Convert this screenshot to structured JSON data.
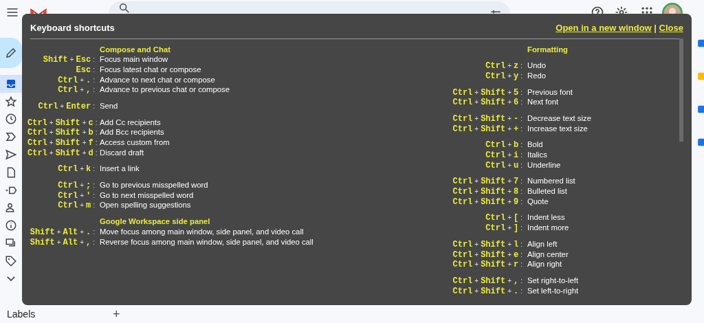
{
  "sidebar": {
    "items": [
      {
        "kind": "inbox",
        "selected": true
      },
      {
        "kind": "star",
        "selected": false
      },
      {
        "kind": "clock",
        "selected": false
      },
      {
        "kind": "important",
        "selected": false
      },
      {
        "kind": "send",
        "selected": false
      },
      {
        "kind": "file",
        "selected": false
      },
      {
        "kind": "label",
        "selected": false
      },
      {
        "kind": "people",
        "selected": false
      },
      {
        "kind": "info",
        "selected": false
      },
      {
        "kind": "forum",
        "selected": false
      },
      {
        "kind": "tag",
        "selected": false
      },
      {
        "kind": "chevron",
        "selected": false
      }
    ],
    "labels_heading": "Labels",
    "add_label": "+"
  },
  "shortcuts_dialog": {
    "title": "Keyboard shortcuts",
    "links": [
      {
        "label": "Open in a new window"
      },
      {
        "label": "Close"
      }
    ],
    "link_divider": "|",
    "key_joiner": "+",
    "separator": ":",
    "columns": [
      {
        "sections": [
          {
            "heading": "Compose and Chat",
            "groups": [
              [
                {
                  "keys": [
                    "Shift",
                    "Esc"
                  ],
                  "action": "Focus main window"
                },
                {
                  "keys": [
                    "Esc"
                  ],
                  "action": "Focus latest chat or compose"
                },
                {
                  "keys": [
                    "Ctrl",
                    "."
                  ],
                  "action": "Advance to next chat or compose"
                },
                {
                  "keys": [
                    "Ctrl",
                    ","
                  ],
                  "action": "Advance to previous chat or compose"
                }
              ],
              [
                {
                  "keys": [
                    "Ctrl",
                    "Enter"
                  ],
                  "action": "Send"
                }
              ],
              [
                {
                  "keys": [
                    "Ctrl",
                    "Shift",
                    "c"
                  ],
                  "action": "Add Cc recipients"
                },
                {
                  "keys": [
                    "Ctrl",
                    "Shift",
                    "b"
                  ],
                  "action": "Add Bcc recipients"
                },
                {
                  "keys": [
                    "Ctrl",
                    "Shift",
                    "f"
                  ],
                  "action": "Access custom from"
                },
                {
                  "keys": [
                    "Ctrl",
                    "Shift",
                    "d"
                  ],
                  "action": "Discard draft"
                }
              ],
              [
                {
                  "keys": [
                    "Ctrl",
                    "k"
                  ],
                  "action": "Insert a link"
                }
              ],
              [
                {
                  "keys": [
                    "Ctrl",
                    ";"
                  ],
                  "action": "Go to previous misspelled word"
                },
                {
                  "keys": [
                    "Ctrl",
                    "'"
                  ],
                  "action": "Go to next misspelled word"
                },
                {
                  "keys": [
                    "Ctrl",
                    "m"
                  ],
                  "action": "Open spelling suggestions"
                }
              ]
            ]
          },
          {
            "heading": "Google Workspace side panel",
            "groups": [
              [
                {
                  "keys": [
                    "Shift",
                    "Alt",
                    "."
                  ],
                  "action": "Move focus among main window, side panel, and video call"
                },
                {
                  "keys": [
                    "Shift",
                    "Alt",
                    ","
                  ],
                  "action": "Reverse focus among main window, side panel, and video call"
                }
              ]
            ]
          }
        ]
      },
      {
        "sections": [
          {
            "heading": "Formatting",
            "groups": [
              [
                {
                  "keys": [
                    "Ctrl",
                    "z"
                  ],
                  "action": "Undo"
                },
                {
                  "keys": [
                    "Ctrl",
                    "y"
                  ],
                  "action": "Redo"
                }
              ],
              [
                {
                  "keys": [
                    "Ctrl",
                    "Shift",
                    "5"
                  ],
                  "action": "Previous font"
                },
                {
                  "keys": [
                    "Ctrl",
                    "Shift",
                    "6"
                  ],
                  "action": "Next font"
                }
              ],
              [
                {
                  "keys": [
                    "Ctrl",
                    "Shift",
                    "-"
                  ],
                  "action": "Decrease text size"
                },
                {
                  "keys": [
                    "Ctrl",
                    "Shift",
                    "+"
                  ],
                  "action": "Increase text size"
                }
              ],
              [
                {
                  "keys": [
                    "Ctrl",
                    "b"
                  ],
                  "action": "Bold"
                },
                {
                  "keys": [
                    "Ctrl",
                    "i"
                  ],
                  "action": "Italics"
                },
                {
                  "keys": [
                    "Ctrl",
                    "u"
                  ],
                  "action": "Underline"
                }
              ],
              [
                {
                  "keys": [
                    "Ctrl",
                    "Shift",
                    "7"
                  ],
                  "action": "Numbered list"
                },
                {
                  "keys": [
                    "Ctrl",
                    "Shift",
                    "8"
                  ],
                  "action": "Bulleted list"
                },
                {
                  "keys": [
                    "Ctrl",
                    "Shift",
                    "9"
                  ],
                  "action": "Quote"
                }
              ],
              [
                {
                  "keys": [
                    "Ctrl",
                    "["
                  ],
                  "action": "Indent less"
                },
                {
                  "keys": [
                    "Ctrl",
                    "]"
                  ],
                  "action": "Indent more"
                }
              ],
              [
                {
                  "keys": [
                    "Ctrl",
                    "Shift",
                    "l"
                  ],
                  "action": "Align left"
                },
                {
                  "keys": [
                    "Ctrl",
                    "Shift",
                    "e"
                  ],
                  "action": "Align center"
                },
                {
                  "keys": [
                    "Ctrl",
                    "Shift",
                    "r"
                  ],
                  "action": "Align right"
                }
              ],
              [
                {
                  "keys": [
                    "Ctrl",
                    "Shift",
                    ","
                  ],
                  "action": "Set right-to-left"
                },
                {
                  "keys": [
                    "Ctrl",
                    "Shift",
                    "."
                  ],
                  "action": "Set left-to-right"
                }
              ]
            ]
          }
        ]
      }
    ]
  }
}
